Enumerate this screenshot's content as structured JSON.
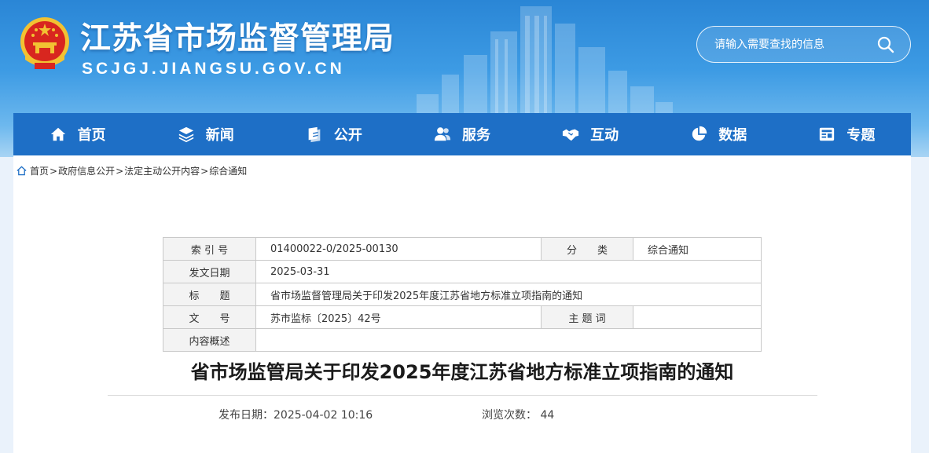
{
  "header": {
    "title": "江苏省市场监督管理局",
    "url": "SCJGJ.JIANGSU.GOV.CN",
    "emblem_icon": "national-emblem-icon"
  },
  "search": {
    "placeholder": "请输入需要查找的信息",
    "icon": "search-icon"
  },
  "nav": {
    "items": [
      {
        "label": "首页",
        "icon": "home-icon"
      },
      {
        "label": "新闻",
        "icon": "layers-icon"
      },
      {
        "label": "公开",
        "icon": "docs-icon"
      },
      {
        "label": "服务",
        "icon": "users-icon"
      },
      {
        "label": "互动",
        "icon": "handshake-icon"
      },
      {
        "label": "数据",
        "icon": "pie-chart-icon"
      },
      {
        "label": "专题",
        "icon": "monitor-icon"
      }
    ]
  },
  "breadcrumb": {
    "items": [
      "首页",
      "政府信息公开",
      "法定主动公开内容",
      "综合通知"
    ],
    "separator": ">"
  },
  "meta": {
    "index_label": "索 引 号",
    "index_value": "01400022-0/2025-00130",
    "category_label": "分　　类",
    "category_value": "综合通知",
    "date_label": "发文日期",
    "date_value": "2025-03-31",
    "title_label": "标　　题",
    "title_value": "省市场监督管理局关于印发2025年度江苏省地方标准立项指南的通知",
    "docno_label": "文　　号",
    "docno_value": "苏市监标〔2025〕42号",
    "keywords_label": "主 题 词",
    "keywords_value": "",
    "summary_label": "内容概述",
    "summary_value": ""
  },
  "article": {
    "title": "省市场监管局关于印发2025年度江苏省地方标准立项指南的通知",
    "publish_label": "发布日期：",
    "publish_date": "2025-04-02 10:16",
    "views_label": "浏览次数：",
    "views": "44"
  },
  "colors": {
    "nav_bg": "#1e6fc6",
    "header_top": "#2a86d6",
    "page_bg": "#eaf2fb"
  }
}
